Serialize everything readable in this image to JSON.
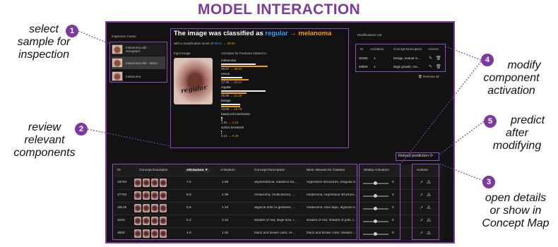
{
  "title": "MODEL INTERACTION",
  "annotations": [
    {
      "num": "1",
      "text_lines": [
        "select",
        "sample for",
        "inspection"
      ]
    },
    {
      "num": "2",
      "text_lines": [
        "review",
        "relevant",
        "components"
      ]
    },
    {
      "num": "3",
      "text_lines": [
        "open details",
        "or show in",
        "Concept Map"
      ]
    },
    {
      "num": "4",
      "text_lines": [
        "modify",
        "component",
        "activation"
      ]
    },
    {
      "num": "5",
      "text_lines": [
        "predict",
        "after",
        "modifying"
      ]
    }
  ],
  "inspection": {
    "header": "Inspection Cases",
    "items": [
      "melanoma edit - elongated",
      "melanoma edit - tattoo",
      "melanoma"
    ]
  },
  "classification": {
    "heading_prefix": "The image was classified as",
    "from_label": "regular",
    "arrow": "→",
    "to_label": "melanoma",
    "score_prefix": "with a classification score of",
    "score_from": "38.91",
    "score_to": "38.62",
    "input_label": "Input Image",
    "features_label": "Activates for Features related to:",
    "features": [
      {
        "name": "melanoma",
        "from": "28.57",
        "to": "38.62"
      },
      {
        "name": "nevus",
        "from": "17.49",
        "to": "22.67"
      },
      {
        "name": "regular",
        "from": "36.95",
        "to": "21.29"
      },
      {
        "name": "benign",
        "from": "15.65",
        "to": "15.76"
      },
      {
        "name": "basal cell carcinoma",
        "from": "1.01",
        "to": "1.13"
      },
      {
        "name": "actinic keratosis",
        "from": "0.41",
        "to": "0.49"
      }
    ],
    "tattoo_text": "regular"
  },
  "modifications": {
    "header": "Modifications List",
    "columns": [
      "ID",
      "Activation",
      "Concept Description",
      "Actions"
    ],
    "rows": [
      {
        "id": "30486",
        "activation": "-1",
        "desc": "benign, textual m..."
      },
      {
        "id": "28900",
        "activation": "-1",
        "desc": "large growth, mo..."
      }
    ],
    "remove_all": "Remove all"
  },
  "reload_label": "Reload prediction",
  "table": {
    "columns": [
      "ID",
      "Concept Examples",
      "Attribution ▼",
      "Activation",
      "Concept Description",
      "Most relevant for Classes",
      "Modify Activation",
      "Actions"
    ],
    "rows": [
      {
        "id": "19764",
        "attr": "7.5",
        "act": "1.86",
        "desc": "asymmetrical, indistinct bo...",
        "classes": "regression structures, irregular b...",
        "mod": "0"
      },
      {
        "id": "27752",
        "attr": "6.9",
        "act": "1.06",
        "desc": "melanoma, multicolored, ...",
        "classes": "melanoma, regression structure...",
        "mod": "0"
      },
      {
        "id": "28126",
        "attr": "5.6",
        "act": "1.34",
        "desc": "atypical dots or globules, ...",
        "classes": "melanoma, blue tape, atypical d...",
        "mod": "0"
      },
      {
        "id": "2020",
        "attr": "5.4",
        "act": "2.31",
        "desc": "shades of red, large size, r...",
        "classes": "shades of red, shades of pink, r...",
        "mod": "0"
      },
      {
        "id": "3860",
        "attr": "4.9",
        "act": "1.30",
        "desc": "black and brown color, re...",
        "classes": "black and brown color, shades ...",
        "mod": "0"
      }
    ]
  },
  "colors": {
    "accent": "#7c3aa0",
    "regular": "#3b9cff",
    "melanoma": "#f59e0b"
  }
}
